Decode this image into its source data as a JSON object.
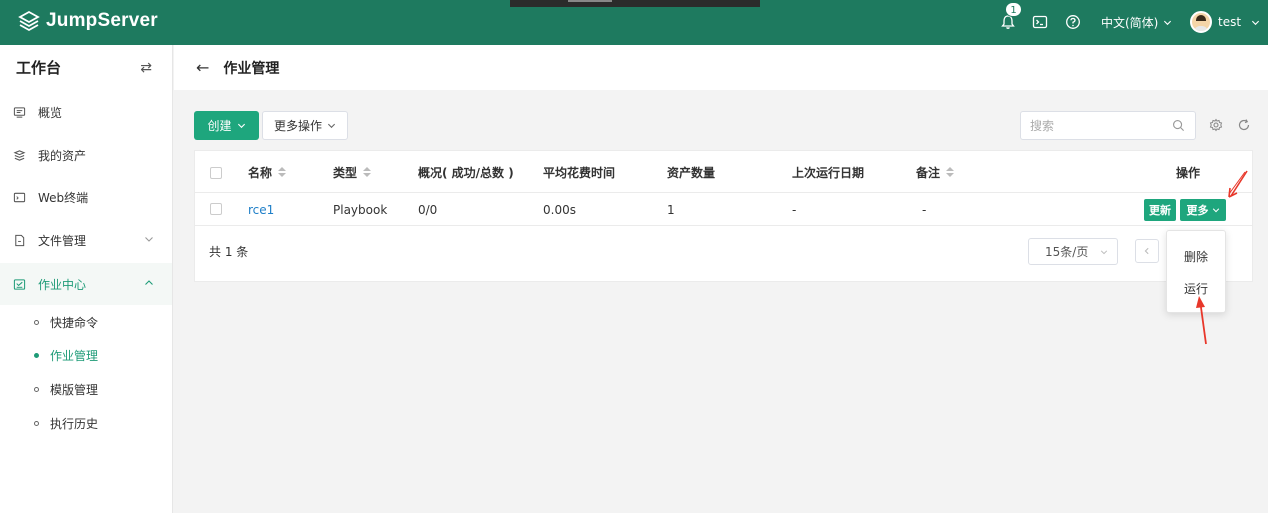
{
  "app": {
    "name": "JumpServer"
  },
  "topbar": {
    "notification_count": "1",
    "language": "中文(简体)",
    "username": "test",
    "icons": [
      "bell-icon",
      "terminal-icon",
      "help-icon"
    ]
  },
  "sidebar": {
    "title": "工作台",
    "items": [
      {
        "label": "概览",
        "icon": "overview-icon"
      },
      {
        "label": "我的资产",
        "icon": "assets-icon"
      },
      {
        "label": "Web终端",
        "icon": "terminal-icon"
      },
      {
        "label": "文件管理",
        "icon": "file-icon"
      },
      {
        "label": "作业中心",
        "icon": "job-icon"
      }
    ],
    "sub_items": [
      {
        "label": "快捷命令"
      },
      {
        "label": "作业管理"
      },
      {
        "label": "模版管理"
      },
      {
        "label": "执行历史"
      }
    ]
  },
  "page": {
    "title": "作业管理"
  },
  "toolbar": {
    "create_label": "创建",
    "more_actions_label": "更多操作",
    "search_placeholder": "搜索"
  },
  "table": {
    "columns": [
      "名称",
      "类型",
      "概况( 成功/总数 )",
      "平均花费时间",
      "资产数量",
      "上次运行日期",
      "备注",
      "操作"
    ],
    "rows": [
      {
        "name": "rce1",
        "type": "Playbook",
        "summary": "0/0",
        "avg_time": "0.00s",
        "asset_count": "1",
        "last_run": "-",
        "comment": "-"
      }
    ],
    "actions": {
      "update": "更新",
      "more": "更多"
    }
  },
  "pagination": {
    "total": "共 1 条",
    "page_size": "15条/页"
  },
  "dropdown": {
    "items": [
      "删除",
      "运行"
    ]
  },
  "colors": {
    "brand": "#1e7a5f",
    "primary": "#1ea67d",
    "link": "#1f7fc8",
    "annotation": "#e8372a"
  }
}
